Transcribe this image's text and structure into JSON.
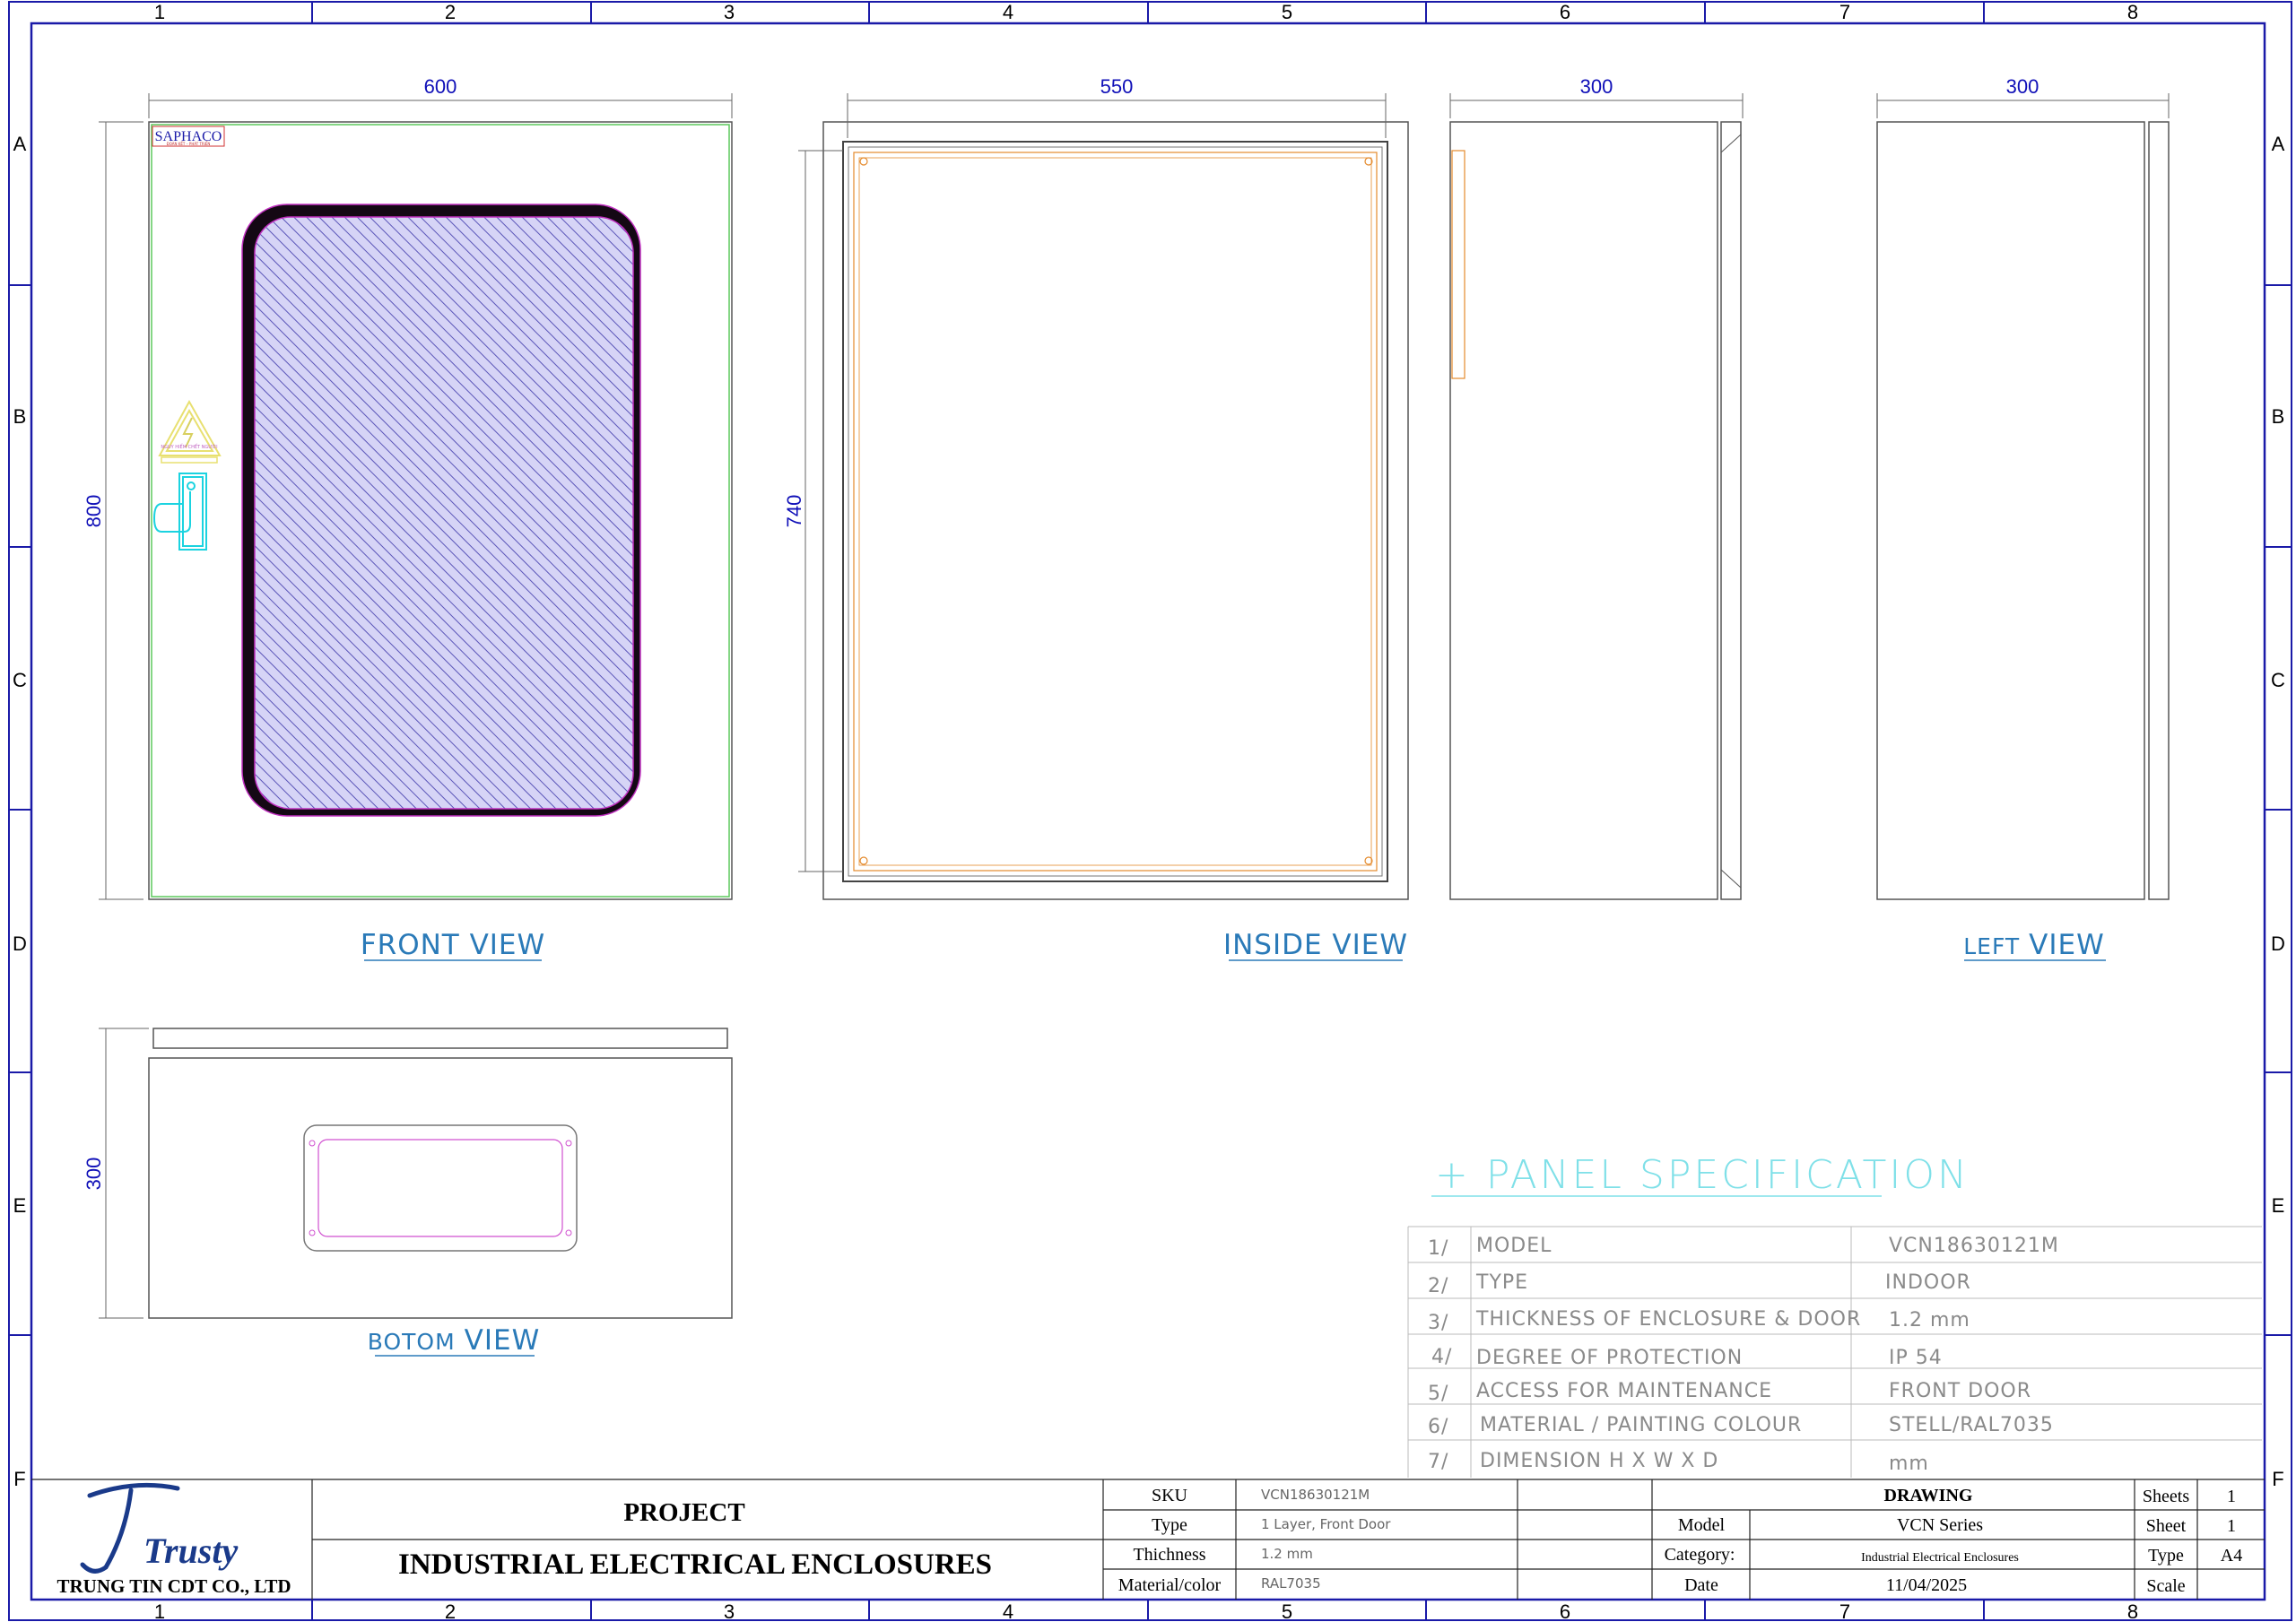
{
  "grid": {
    "columns": [
      "1",
      "2",
      "3",
      "4",
      "5",
      "6",
      "7",
      "8"
    ],
    "rows": [
      "A",
      "B",
      "C",
      "D",
      "E",
      "F"
    ]
  },
  "views": {
    "front": {
      "label": "FRONT VIEW",
      "width_dim": "600",
      "height_dim": "800",
      "logo": "SAPHACO",
      "logo_sub": "ĐOÀN KẾT – PHÁT TRIỂN",
      "warning_text": "NGUY HIỂM CHẾT NGƯỜI"
    },
    "inside": {
      "label": "INSIDE VIEW",
      "width_dim": "550",
      "height_dim": "740"
    },
    "side": {
      "width_dim": "300"
    },
    "left": {
      "label_small": "LEFT",
      "label": "VIEW",
      "width_dim": "300"
    },
    "bottom": {
      "label_small": "BOTOM",
      "label": "VIEW",
      "height_dim": "300"
    }
  },
  "specification": {
    "title": "+ PANEL SPECIFICATION",
    "rows": [
      {
        "num": "1/",
        "name": "MODEL",
        "value": "VCN18630121M"
      },
      {
        "num": "2/",
        "name": "TYPE",
        "value": "INDOOR"
      },
      {
        "num": "3/",
        "name": "THICKNESS OF ENCLOSURE & DOOR",
        "value": "1.2 mm"
      },
      {
        "num": "4/",
        "name": "DEGREE OF PROTECTION",
        "value": "IP 54"
      },
      {
        "num": "5/",
        "name": "ACCESS FOR MAINTENANCE",
        "value": "FRONT DOOR"
      },
      {
        "num": "6/",
        "name": "MATERIAL / PAINTING COLOUR",
        "value": "STELL/RAL7035"
      },
      {
        "num": "7/",
        "name": "DIMENSION  H X W X D",
        "value": "mm"
      }
    ]
  },
  "title_block": {
    "company_logo": "Trusty",
    "company_name": "TRUNG TIN CDT CO., LTD",
    "project_label": "PROJECT",
    "project_name": "INDUSTRIAL ELECTRICAL ENCLOSURES",
    "fields": [
      {
        "label": "SKU",
        "value": "VCN18630121M"
      },
      {
        "label": "Type",
        "value": "1 Layer, Front Door"
      },
      {
        "label": "Thichness",
        "value": "1.2 mm"
      },
      {
        "label": "Material/color",
        "value": "RAL7035"
      }
    ],
    "drawing_label": "DRAWING",
    "drawing_fields": [
      {
        "label": "Model",
        "value": "VCN Series"
      },
      {
        "label": "Category:",
        "value": "Industrial Electrical Enclosures"
      },
      {
        "label": "Date",
        "value": "11/04/2025"
      }
    ],
    "sheet_fields": [
      {
        "label": "Sheets",
        "value": "1"
      },
      {
        "label": "Sheet",
        "value": "1"
      },
      {
        "label": "Type",
        "value": "A4"
      },
      {
        "label": "Scale",
        "value": ""
      }
    ]
  },
  "colors": {
    "frame": "#1a1aa8",
    "dimension": "#1010b8",
    "view_label": "#2a7ab8",
    "spec_title": "#7fe0e8",
    "door_outline": "#5cc85c",
    "window_fill": "#c9c6f0",
    "gasket": "#e48a2c",
    "handle": "#1bd3e0"
  }
}
